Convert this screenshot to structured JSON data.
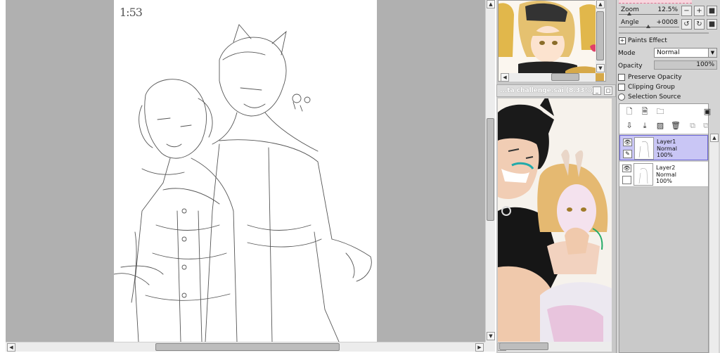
{
  "canvas": {
    "timestamp_text": "1:53"
  },
  "reference_windows": {
    "bottom_title": "...ta challenge.sai (8.33%)"
  },
  "panel": {
    "zoom_label": "Zoom",
    "zoom_value": "12.5%",
    "angle_label": "Angle",
    "angle_value": "+0008",
    "paints_effect_label": "Paints Effect",
    "mode_label": "Mode",
    "mode_value": "Normal",
    "opacity_label": "Opacity",
    "opacity_value": "100%",
    "preserve_opacity_label": "Preserve Opacity",
    "clipping_group_label": "Clipping Group",
    "selection_source_label": "Selection Source"
  },
  "layers": [
    {
      "name": "Layer1",
      "mode": "Normal",
      "opacity": "100%",
      "selected": true
    },
    {
      "name": "Layer2",
      "mode": "Normal",
      "opacity": "100%",
      "selected": false
    }
  ],
  "icons": {
    "zoom_out": "minus-icon",
    "zoom_in": "plus-icon",
    "zoom_reset": "square-icon",
    "rotate_left": "rotate-left-icon",
    "rotate_right": "rotate-right-icon",
    "rotate_reset": "square-icon",
    "new_layer": "new-layer-icon",
    "new_folder": "folder-icon",
    "delete_layer": "trash-icon",
    "eye": "eye-icon"
  }
}
